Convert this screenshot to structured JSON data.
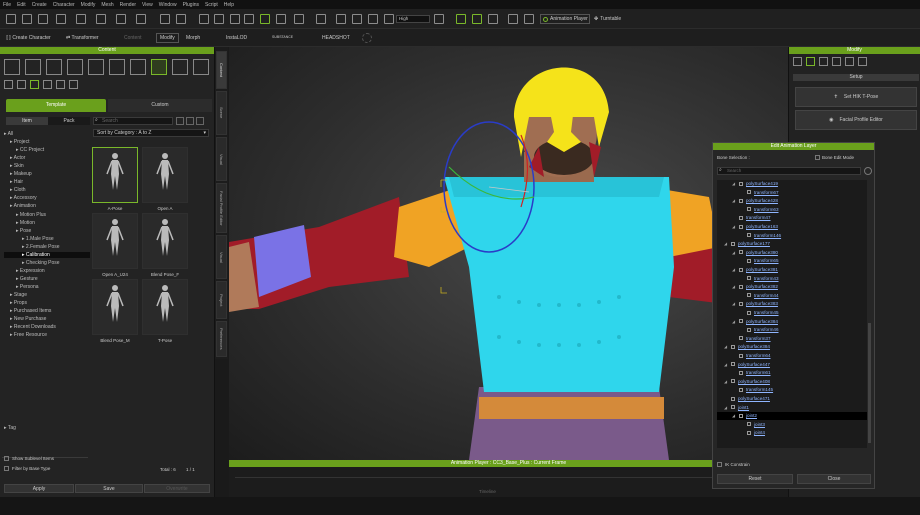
{
  "menu": [
    "File",
    "Edit",
    "Create",
    "Character",
    "Modify",
    "Mesh",
    "Render",
    "View",
    "Window",
    "Plugins",
    "Script",
    "Help"
  ],
  "toolbar": {
    "quality": "High",
    "animation_player": "Animation Player",
    "turntable": "Turntable",
    "create_character": "Create Character",
    "transformer": "Transformer",
    "content": "Content",
    "modify": "Modify",
    "morph": "Morph",
    "instalod": "InstaLOD",
    "subtitle": "SUBSTANCE",
    "headshot": "HEADSHOT"
  },
  "left_panel": {
    "title": "Content",
    "tab_template": "Template",
    "tab_custom": "Custom",
    "tab_item": "Item",
    "tab_pack": "Pack",
    "search_placeholder": "Search",
    "sort": "Sort by Category : A to Z",
    "tree": [
      {
        "label": "All",
        "indent": 0
      },
      {
        "label": "Project",
        "indent": 1
      },
      {
        "label": "CC Project",
        "indent": 2
      },
      {
        "label": "Actor",
        "indent": 1
      },
      {
        "label": "Skin",
        "indent": 1
      },
      {
        "label": "Makeup",
        "indent": 1
      },
      {
        "label": "Hair",
        "indent": 1
      },
      {
        "label": "Cloth",
        "indent": 1
      },
      {
        "label": "Accessory",
        "indent": 1
      },
      {
        "label": "Animation",
        "indent": 1
      },
      {
        "label": "Motion Plus",
        "indent": 2
      },
      {
        "label": "Motion",
        "indent": 2
      },
      {
        "label": "Pose",
        "indent": 2
      },
      {
        "label": "1.Male Pose",
        "indent": 3
      },
      {
        "label": "2.Female Pose",
        "indent": 3
      },
      {
        "label": "Calibration",
        "indent": 3,
        "selected": true
      },
      {
        "label": "Checking Pose",
        "indent": 3
      },
      {
        "label": "Expression",
        "indent": 2
      },
      {
        "label": "Gesture",
        "indent": 2
      },
      {
        "label": "Persona",
        "indent": 2
      },
      {
        "label": "Stage",
        "indent": 1
      },
      {
        "label": "Props",
        "indent": 1
      },
      {
        "label": "Purchased Items",
        "indent": 1
      },
      {
        "label": "New Purchase",
        "indent": 1
      },
      {
        "label": "Recent Downloads",
        "indent": 1
      },
      {
        "label": "Free Resource",
        "indent": 1
      },
      {
        "label": "Tag",
        "indent": 0
      }
    ],
    "thumbs": [
      "A-Pose",
      "Open A",
      "Open A_U24",
      "Blend Pose_F",
      "Blend Pose_M",
      "T-Pose"
    ],
    "show_sublevel": "Show Sublevel Items",
    "filter": "Filter by Base Type",
    "total": "Total : 6",
    "page": "1 / 1",
    "apply": "Apply",
    "save": "Save",
    "overwrite": "Overwrite"
  },
  "side_tabs": [
    "Content",
    "Scene",
    "Visual",
    "Facial Profile Editor",
    "Visual",
    "Project",
    "Preferences"
  ],
  "viewport": {
    "anim_bar": "Animation Player : CC3_Base_Plus : Current Frame",
    "timeline": "Timeline"
  },
  "right_panel": {
    "title": "Modify",
    "setup": "Setup",
    "set_hik": "Set HIK T-Pose",
    "facial": "Facial Profile Editor"
  },
  "dialog": {
    "title": "Edit Animation Layer",
    "bone_selection": "Bone Selection :",
    "bone_edit": "Bone Edit Mode",
    "search": "Search",
    "items": [
      {
        "t": "polySurface419",
        "d": 1,
        "x": true
      },
      {
        "t": "transform67",
        "d": 2
      },
      {
        "t": "polySurface428",
        "d": 1,
        "x": true
      },
      {
        "t": "transform63",
        "d": 2
      },
      {
        "t": "transform47",
        "d": 1
      },
      {
        "t": "polySurface163",
        "d": 1,
        "x": true
      },
      {
        "t": "transform146",
        "d": 2
      },
      {
        "t": "polySurface177",
        "d": 0,
        "x": true
      },
      {
        "t": "polySurface380",
        "d": 1,
        "x": true
      },
      {
        "t": "transform65",
        "d": 2
      },
      {
        "t": "polySurface381",
        "d": 1,
        "x": true
      },
      {
        "t": "transform43",
        "d": 2
      },
      {
        "t": "polySurface382",
        "d": 1,
        "x": true
      },
      {
        "t": "transform44",
        "d": 2
      },
      {
        "t": "polySurface383",
        "d": 1,
        "x": true
      },
      {
        "t": "transform45",
        "d": 2
      },
      {
        "t": "polySurface384",
        "d": 1,
        "x": true
      },
      {
        "t": "transform46",
        "d": 2
      },
      {
        "t": "transform37",
        "d": 1
      },
      {
        "t": "polySurface384",
        "d": 0,
        "x": true
      },
      {
        "t": "transform64",
        "d": 1
      },
      {
        "t": "polySurface447",
        "d": 0,
        "x": true
      },
      {
        "t": "transform61",
        "d": 1
      },
      {
        "t": "polySurface408",
        "d": 0,
        "x": true
      },
      {
        "t": "transform145",
        "d": 1
      },
      {
        "t": "polySurface471",
        "d": 0
      },
      {
        "t": "joint1",
        "d": 0,
        "x": true
      },
      {
        "t": "joint2",
        "d": 1,
        "x": true,
        "sel": true
      },
      {
        "t": "joint3",
        "d": 2
      },
      {
        "t": "joint4",
        "d": 2
      }
    ],
    "ik": "IK Constrain",
    "reset": "Reset",
    "close": "Close"
  }
}
